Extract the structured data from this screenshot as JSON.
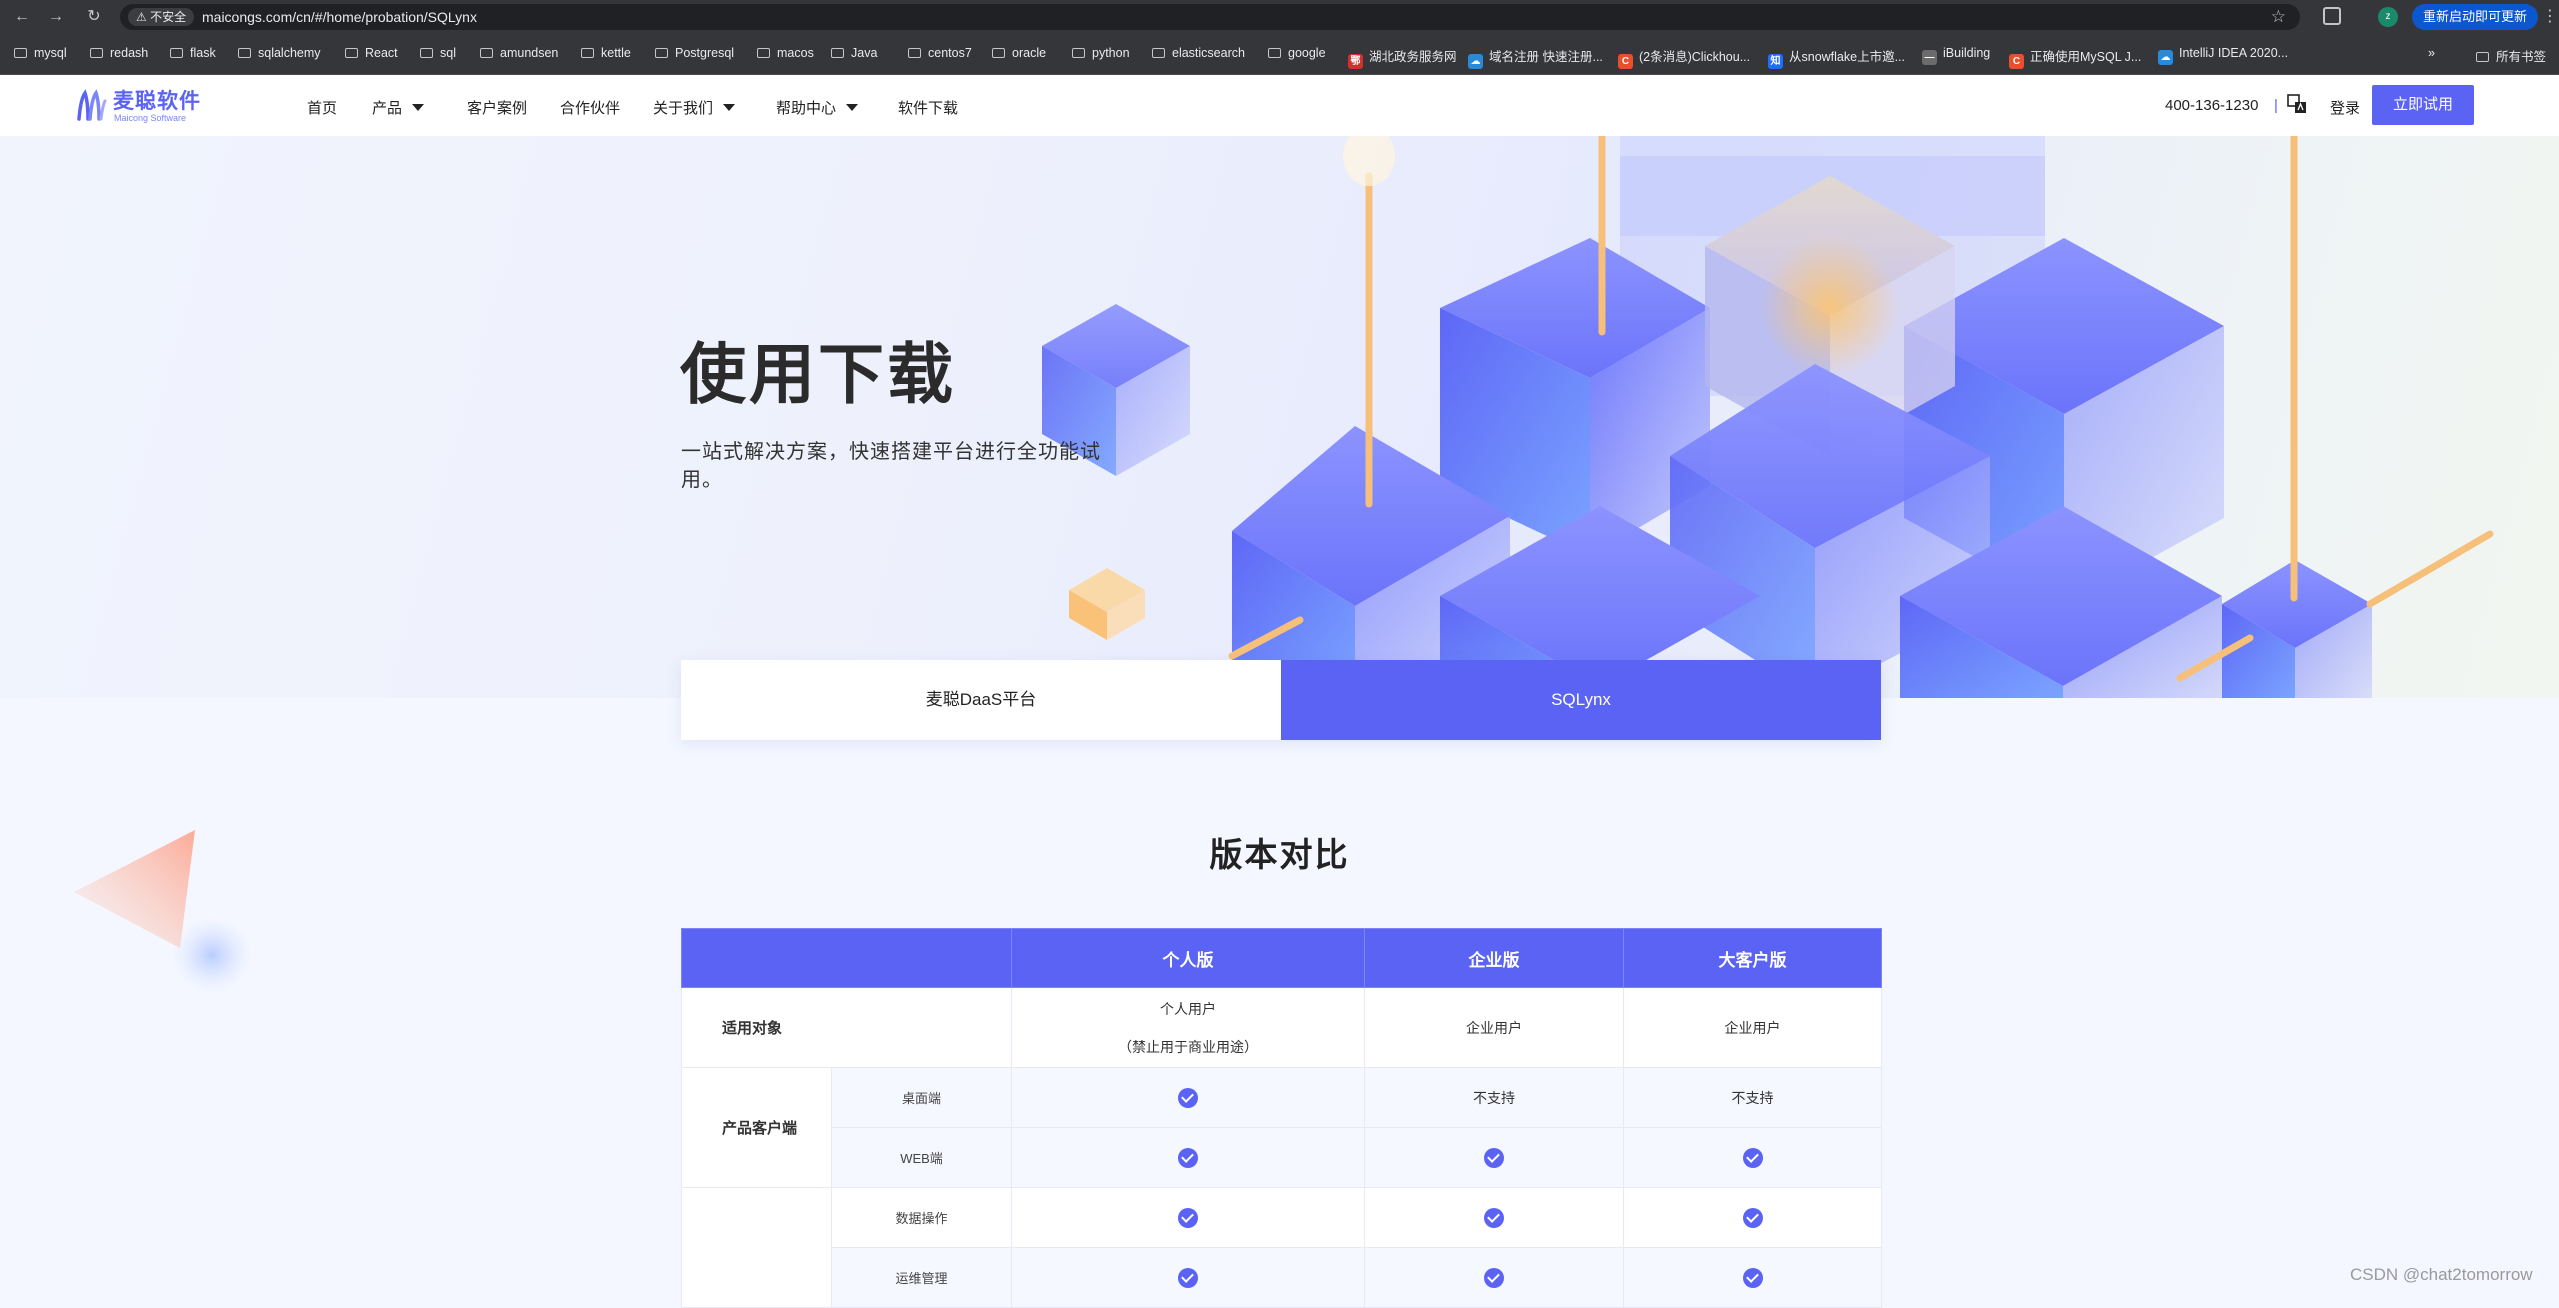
{
  "browser": {
    "insecure_label": "不安全",
    "url": "maicongs.com/cn/#/home/probation/SQLynx",
    "profile_initial": "z",
    "update_label": "重新启动即可更新"
  },
  "bookmarks": [
    {
      "label": "mysql",
      "kind": "folder"
    },
    {
      "label": "redash",
      "kind": "folder"
    },
    {
      "label": "flask",
      "kind": "folder"
    },
    {
      "label": "sqlalchemy",
      "kind": "folder"
    },
    {
      "label": "React",
      "kind": "folder"
    },
    {
      "label": "sql",
      "kind": "folder"
    },
    {
      "label": "amundsen",
      "kind": "folder"
    },
    {
      "label": "kettle",
      "kind": "folder"
    },
    {
      "label": "Postgresql",
      "kind": "folder"
    },
    {
      "label": "macos",
      "kind": "folder"
    },
    {
      "label": "Java",
      "kind": "folder"
    },
    {
      "label": "centos7",
      "kind": "folder"
    },
    {
      "label": "oracle",
      "kind": "folder"
    },
    {
      "label": "python",
      "kind": "folder"
    },
    {
      "label": "elasticsearch",
      "kind": "folder"
    },
    {
      "label": "google",
      "kind": "folder"
    },
    {
      "label": "湖北政务服务网",
      "kind": "site",
      "color": "#d0312d",
      "glyph": "鄂"
    },
    {
      "label": "域名注册 快速注册...",
      "kind": "site",
      "color": "#2b8ad8",
      "glyph": "☁"
    },
    {
      "label": "(2条消息)Clickhou...",
      "kind": "site",
      "color": "#e84f2c",
      "glyph": "C"
    },
    {
      "label": "从snowflake上市邀...",
      "kind": "site",
      "color": "#1e6fff",
      "glyph": "知"
    },
    {
      "label": "iBuilding",
      "kind": "site",
      "color": "#6b6b6b",
      "glyph": "—"
    },
    {
      "label": "正确使用MySQL J...",
      "kind": "site",
      "color": "#e84f2c",
      "glyph": "C"
    },
    {
      "label": "IntelliJ IDEA 2020...",
      "kind": "site",
      "color": "#2b8ad8",
      "glyph": "☁"
    }
  ],
  "bookmarks_overflow": "»",
  "all_bookmarks": "所有书签",
  "site": {
    "logo_cn": "麦聪软件",
    "logo_en": "Maicong Software",
    "nav": [
      {
        "label": "首页",
        "dropdown": false
      },
      {
        "label": "产品",
        "dropdown": true
      },
      {
        "label": "客户案例",
        "dropdown": false
      },
      {
        "label": "合作伙伴",
        "dropdown": false
      },
      {
        "label": "关于我们",
        "dropdown": true
      },
      {
        "label": "帮助中心",
        "dropdown": true
      },
      {
        "label": "软件下载",
        "dropdown": false
      }
    ],
    "phone": "400-136-1230",
    "separator": "|",
    "login": "登录",
    "trial": "立即试用"
  },
  "hero": {
    "title": "使用下载",
    "subtitle": "一站式解决方案，快速搭建平台进行全功能试用。"
  },
  "tabs": [
    {
      "label": "麦聪DaaS平台",
      "active": false
    },
    {
      "label": "SQLynx",
      "active": true
    }
  ],
  "comparison": {
    "title": "版本对比",
    "headers": [
      "",
      "个人版",
      "企业版",
      "大客户版"
    ],
    "audience": {
      "label": "适用对象",
      "personal_line1": "个人用户",
      "personal_line2": "（禁止用于商业用途）",
      "enterprise": "企业用户",
      "vip": "企业用户"
    },
    "client_group": {
      "label": "产品客户端",
      "rows": [
        {
          "feature": "桌面端",
          "personal": true,
          "enterprise": "不支持",
          "vip": "不支持"
        },
        {
          "feature": "WEB端",
          "personal": true,
          "enterprise": true,
          "vip": true
        }
      ]
    },
    "function_rows": [
      {
        "feature": "数据操作",
        "personal": true,
        "enterprise": true,
        "vip": true
      },
      {
        "feature": "运维管理",
        "personal": true,
        "enterprise": true,
        "vip": true
      }
    ]
  },
  "watermark": "CSDN @chat2tomorrow",
  "colors": {
    "accent": "#5b63f5",
    "check": "#5b63f5",
    "pillar": "#f6c07a"
  }
}
